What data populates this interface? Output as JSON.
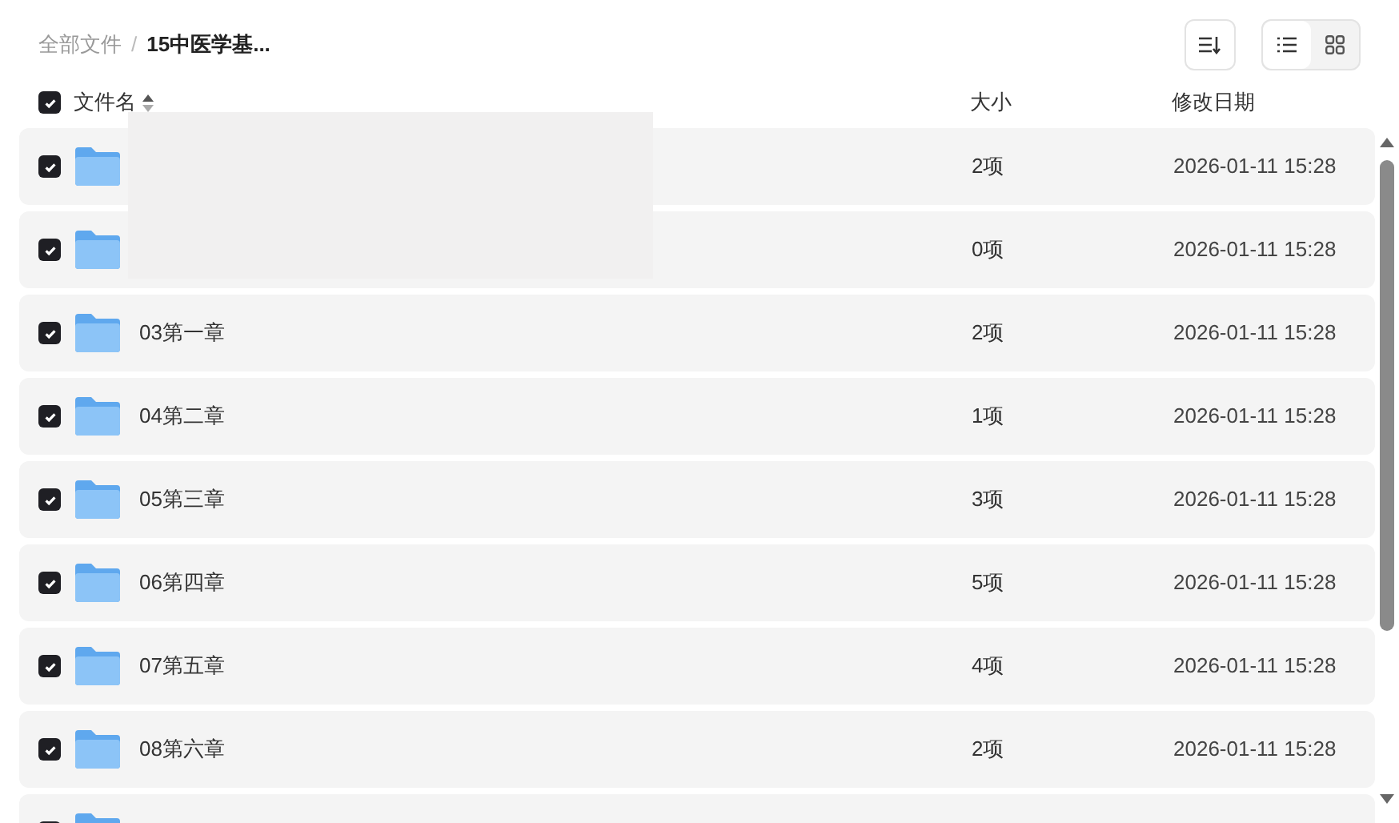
{
  "breadcrumb_separator": "/",
  "breadcrumb": [
    {
      "label": "全部文件",
      "current": false
    },
    {
      "label": "15中医学基...",
      "current": true
    }
  ],
  "view_toggle": [
    {
      "kind": "list",
      "selected": true
    },
    {
      "kind": "grid",
      "selected": false
    }
  ],
  "header": {
    "checked": true,
    "name": "文件名",
    "size": "大小",
    "date": "修改日期"
  },
  "rows": [
    {
      "checked": true,
      "size": "2项",
      "date": "2026-01-11 15:28"
    },
    {
      "checked": true,
      "size": "0项",
      "date": "2026-01-11 15:28"
    },
    {
      "checked": true,
      "name": "03第一章",
      "size": "2项",
      "date": "2026-01-11 15:28"
    },
    {
      "checked": true,
      "name": "04第二章",
      "size": "1项",
      "date": "2026-01-11 15:28"
    },
    {
      "checked": true,
      "name": "05第三章",
      "size": "3项",
      "date": "2026-01-11 15:28"
    },
    {
      "checked": true,
      "name": "06第四章",
      "size": "5项",
      "date": "2026-01-11 15:28"
    },
    {
      "checked": true,
      "name": "07第五章",
      "size": "4项",
      "date": "2026-01-11 15:28"
    },
    {
      "checked": true,
      "name": "08第六章",
      "size": "2项",
      "date": "2026-01-11 15:28"
    },
    {
      "checked": true
    }
  ]
}
